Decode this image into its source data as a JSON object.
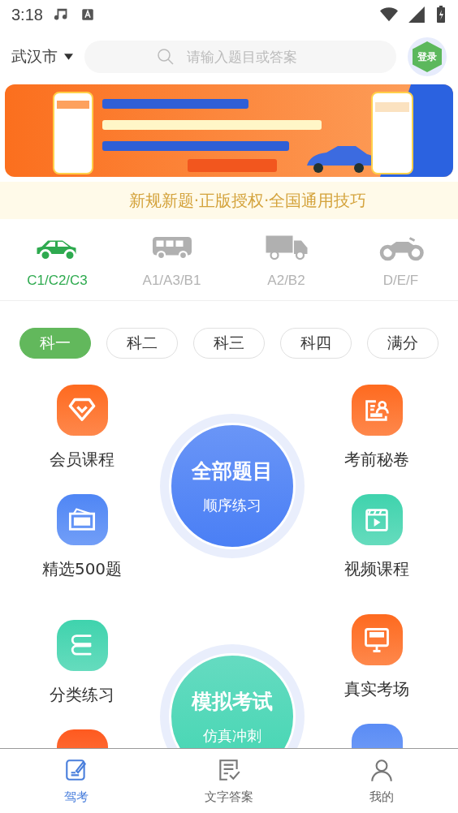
{
  "status_bar": {
    "time": "3:18"
  },
  "header": {
    "city": "武汉市",
    "search": {
      "placeholder": "请输入题目或答案"
    },
    "login": "登录"
  },
  "slogan": "新规新题·正版授权·全国通用技巧",
  "vehicle_tabs": [
    {
      "label": "C1/C2/C3",
      "kind": "car",
      "selected": true
    },
    {
      "label": "A1/A3/B1",
      "kind": "bus",
      "selected": false
    },
    {
      "label": "A2/B2",
      "kind": "truck",
      "selected": false
    },
    {
      "label": "D/E/F",
      "kind": "moto",
      "selected": false
    }
  ],
  "subject_tabs": [
    {
      "label": "科一",
      "selected": true
    },
    {
      "label": "科二",
      "selected": false
    },
    {
      "label": "科三",
      "selected": false
    },
    {
      "label": "科四",
      "selected": false
    },
    {
      "label": "满分",
      "selected": false
    }
  ],
  "left_features": [
    {
      "label": "会员课程",
      "kind": "diamond",
      "color": "#fe6a1f"
    },
    {
      "label": "精选500题",
      "kind": "ticket",
      "color": "#4f86f5"
    },
    {
      "label": "分类练习",
      "kind": "books",
      "color": "#3fd3ad"
    },
    {
      "kind": "stub",
      "color": "#fe5a1f"
    }
  ],
  "practice_modes": [
    {
      "title": "全部题目",
      "subtitle": "顺序练习",
      "color": "#4a7ff5"
    },
    {
      "title": "模拟考试",
      "subtitle": "仿真冲刺",
      "color": "#44d6b2"
    }
  ],
  "right_features": [
    {
      "label": "考前秘卷",
      "kind": "paper",
      "color": "#fe6a1f"
    },
    {
      "label": "视频课程",
      "kind": "video",
      "color": "#3fd3ad"
    },
    {
      "label": "真实考场",
      "kind": "monitor",
      "color": "#fe6a1f"
    },
    {
      "kind": "stub",
      "color": "#5a8cf5"
    }
  ],
  "bottom_nav": [
    {
      "label": "驾考",
      "kind": "edit",
      "selected": true
    },
    {
      "label": "文字答案",
      "kind": "doc",
      "selected": false
    },
    {
      "label": "我的",
      "kind": "user",
      "selected": false
    }
  ]
}
